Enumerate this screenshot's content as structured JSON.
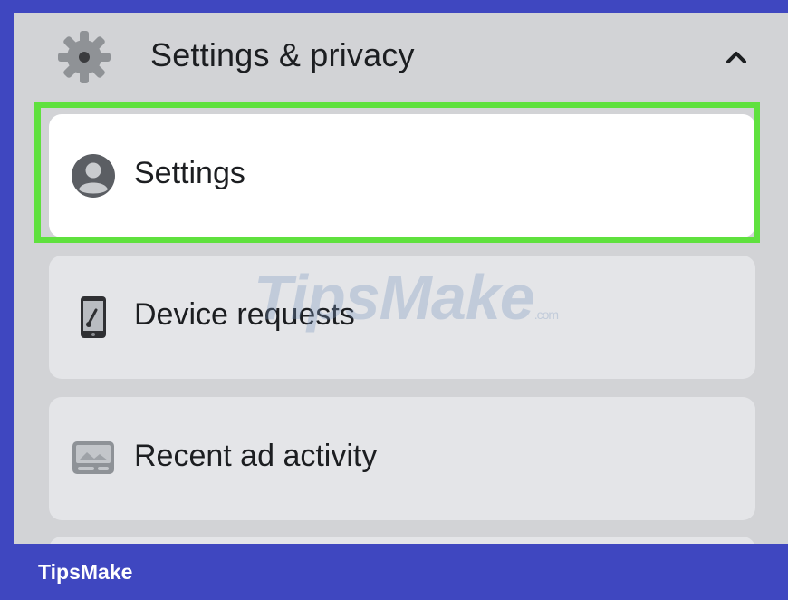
{
  "menu": {
    "section_title": "Settings & privacy",
    "section_icon": "gear-icon",
    "expand_icon": "chevron-up-icon",
    "items": [
      {
        "label": "Settings",
        "icon": "profile-icon",
        "selected": true
      },
      {
        "label": "Device requests",
        "icon": "phone-icon",
        "selected": false
      },
      {
        "label": "Recent ad activity",
        "icon": "ad-activity-icon",
        "selected": false
      }
    ]
  },
  "watermark": {
    "main": "TipsMake",
    "suffix": ".com"
  },
  "footer": {
    "brand": "TipsMake"
  },
  "colors": {
    "frame": "#3f47c0",
    "highlight": "#5fe13e",
    "panel": "#d2d3d6",
    "item": "#e4e5e8"
  }
}
